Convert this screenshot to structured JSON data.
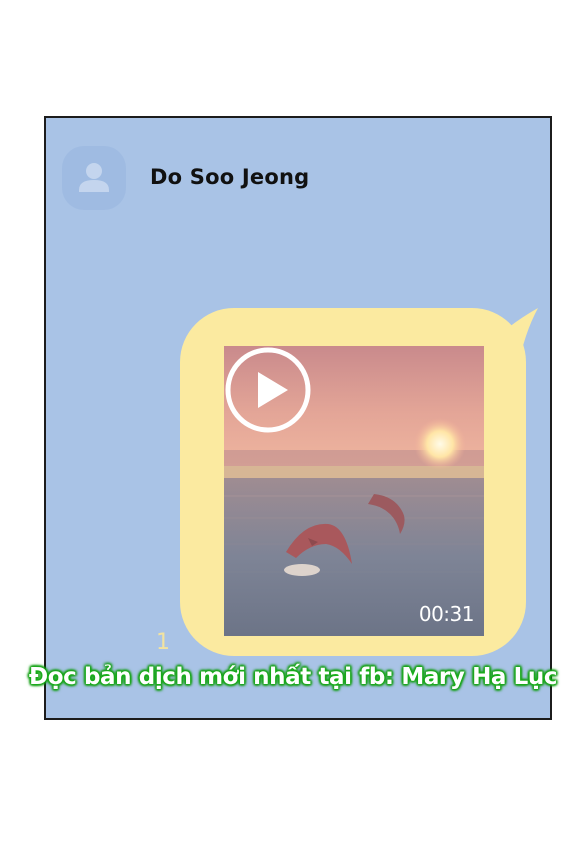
{
  "chat": {
    "sender_name": "Do Soo Jeong",
    "avatar_icon": "person-silhouette-icon",
    "message": {
      "type": "video",
      "duration": "00:31",
      "play_icon": "play-icon",
      "unread_count": "1"
    },
    "colors": {
      "background": "#a9c3e6",
      "bubble": "#fbeaa0",
      "avatar": "#9fbbe2"
    }
  },
  "watermark": {
    "text": "Đọc bản dịch mới nhất tại fb: Mary Hạ Lục",
    "glow_color": "#1eb81e"
  }
}
